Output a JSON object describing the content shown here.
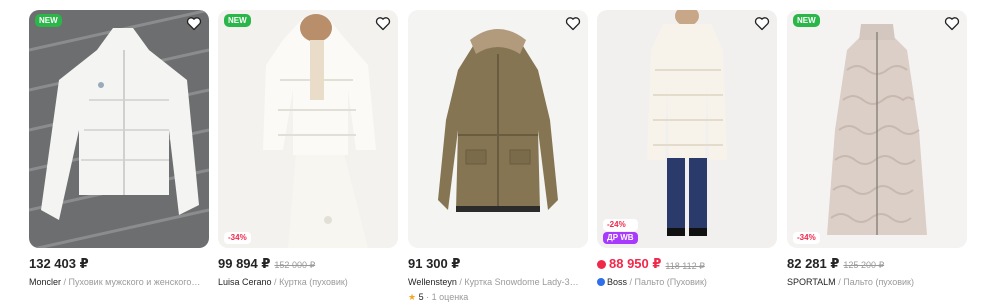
{
  "colors": {
    "accent": "#f0294a",
    "new_badge": "#2bb64a",
    "wb_badge": "#a73afd"
  },
  "products": [
    {
      "new_badge": "NEW",
      "price": "132 403 ₽",
      "brand": "Moncler",
      "separator": " / ",
      "description": "Пуховик мужского и женского…"
    },
    {
      "new_badge": "NEW",
      "discount_badge": "-34%",
      "price": "99 894 ₽",
      "old_price": "152 000 ₽",
      "brand": "Luisa Cerano",
      "separator": " / ",
      "description": "Куртка (пуховик)"
    },
    {
      "price": "91 300 ₽",
      "brand": "Wellensteyn",
      "separator": " / ",
      "description": "Куртка Snowdome Lady-3…",
      "rating_value": "5",
      "rating_count": "· 1 оценка"
    },
    {
      "discount_badge": "-24%",
      "wb_badge": "ДР WB",
      "price": "88 950 ₽",
      "old_price": "118 112 ₽",
      "brand": "Boss",
      "separator": " / ",
      "description": "Пальто (Пуховик)"
    },
    {
      "new_badge": "NEW",
      "discount_badge": "-34%",
      "price": "82 281 ₽",
      "old_price": "125 200 ₽",
      "brand": "SPORTALM",
      "separator": " / ",
      "description": "Пальто (пуховик)"
    }
  ]
}
